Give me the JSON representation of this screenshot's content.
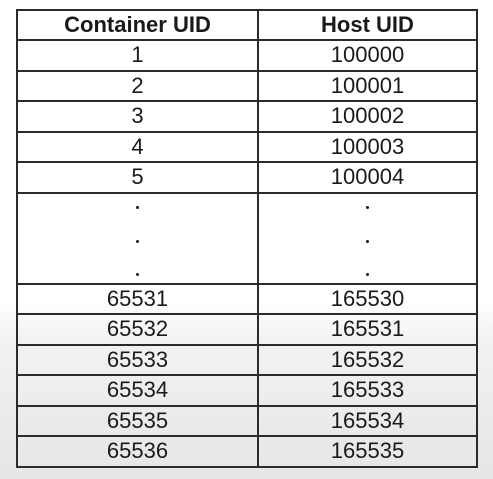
{
  "table": {
    "headers": [
      "Container UID",
      "Host UID"
    ],
    "top_rows": [
      [
        "1",
        "100000"
      ],
      [
        "2",
        "100001"
      ],
      [
        "3",
        "100002"
      ],
      [
        "4",
        "100003"
      ],
      [
        "5",
        "100004"
      ]
    ],
    "bottom_rows": [
      [
        "65531",
        "165530"
      ],
      [
        "65532",
        "165531"
      ],
      [
        "65533",
        "165532"
      ],
      [
        "65534",
        "165533"
      ],
      [
        "65535",
        "165534"
      ],
      [
        "65536",
        "165535"
      ]
    ]
  }
}
